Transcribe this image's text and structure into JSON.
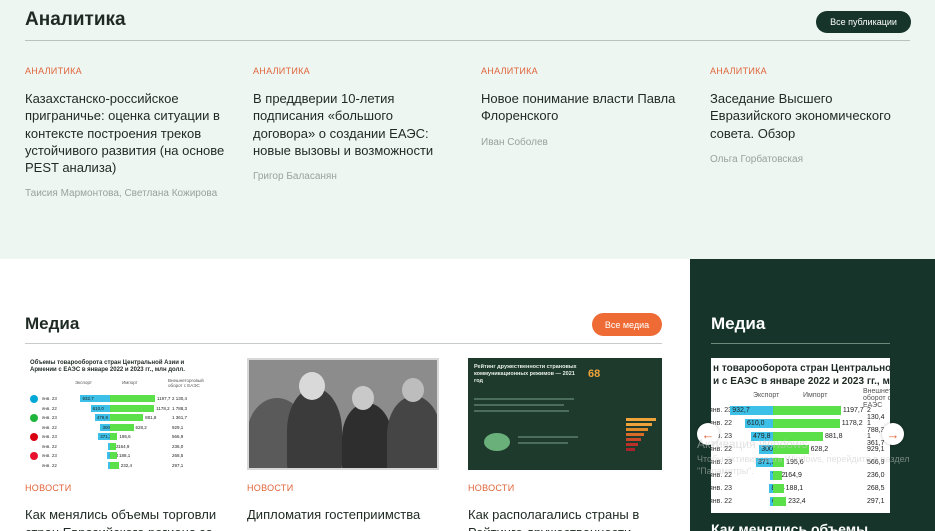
{
  "analytics": {
    "title": "Аналитика",
    "all_button": "Все публикации",
    "articles": [
      {
        "category": "АНАЛИТИКА",
        "title": "Казахстанско-российское приграничье: оценка ситуации в контексте построения треков устойчивого развития (на основе PEST анализа)",
        "author": "Таисия Мармонтова, Светлана Кожирова"
      },
      {
        "category": "АНАЛИТИКА",
        "title": "В преддверии 10-летия подписания «большого договора» о создании ЕАЭС: новые вызовы и возможности",
        "author": "Григор Баласанян"
      },
      {
        "category": "АНАЛИТИКА",
        "title": "Новое понимание власти Павла Флоренского",
        "author": "Иван Соболев"
      },
      {
        "category": "АНАЛИТИКА",
        "title": "Заседание Высшего Евразийского экономического совета. Обзор",
        "author": "Ольга Горбатовская"
      }
    ]
  },
  "media": {
    "title": "Медиа",
    "all_button": "Все медиа",
    "cards": [
      {
        "category": "НОВОСТИ",
        "title": "Как менялись объемы торговли стран Евразийского региона за"
      },
      {
        "category": "НОВОСТИ",
        "title": "Дипломатия гостеприимства"
      },
      {
        "category": "НОВОСТИ",
        "title": "Как располагались страны в Рейтинге дружественности"
      }
    ],
    "infographic": {
      "title": "Объемы товарооборота стран Центральной Азии и Армении с ЕАЭС в январе 2022 и 2023 гг., млн долл.",
      "col_export": "Экспорт",
      "col_import": "Импорт",
      "col_total": "Внешнеторговый оборот с ЕАЭС"
    },
    "report": {
      "title": "Рейтинг дружественности страновых коммуникационных режимов — 2021 год",
      "number": "68"
    }
  },
  "sidebar": {
    "title": "Медиа",
    "card_title_line1": "н товарооборота стран Центральной Азии",
    "card_title_line2": "и с ЕАЭС в январе 2022 и 2023 гг., млн долл.",
    "col_export": "Экспорт",
    "col_import": "Импорт",
    "col_total": "Внешнеторговый оборот с ЕАЭС",
    "prev_icon": "←",
    "next_icon": "→",
    "bottom_text": "Как менялись объемы"
  },
  "trade_rows": [
    {
      "year": "янв. 23",
      "export": 932.7,
      "import": 1197.7,
      "total": "2 130,4",
      "export_label": "932,7",
      "import_label": "1197,7",
      "flag": "#00a8d8"
    },
    {
      "year": "янв. 22",
      "export": 610.0,
      "import": 1178.2,
      "total": "1 788,3",
      "export_label": "610,0",
      "import_label": "1178,2",
      "flag": "#00a8d8"
    },
    {
      "year": "янв. 23",
      "export": 479.8,
      "import": 881.8,
      "total": "1 361,7",
      "export_label": "479,8",
      "import_label": "881,8",
      "flag": "#1eb53a"
    },
    {
      "year": "янв. 22",
      "export": 300.9,
      "import": 628.2,
      "total": "929,1",
      "export_label": "300,9",
      "import_label": "628,2",
      "flag": "#1eb53a"
    },
    {
      "year": "янв. 23",
      "export": 371.3,
      "import": 195.6,
      "total": "566,9",
      "export_label": "371,3",
      "import_label": "195,6",
      "flag": "#d90012"
    },
    {
      "year": "янв. 22",
      "export": 71.2,
      "import": 164.9,
      "total": "236,0",
      "export_label": "71,2",
      "import_label": "164,9",
      "flag": "#d90012"
    },
    {
      "year": "янв. 23",
      "export": 80.4,
      "import": 188.1,
      "total": "268,5",
      "export_label": "80,4",
      "import_label": "188,1",
      "flag": "#e8112d"
    },
    {
      "year": "янв. 22",
      "export": 64.7,
      "import": 232.4,
      "total": "297,1",
      "export_label": "64,7",
      "import_label": "232,4",
      "flag": "#e8112d"
    }
  ],
  "watermark": {
    "line1": "Активация Windows",
    "line2": "Чтобы активировать Windows, перейдите в раздел \"Параметры\"."
  },
  "colors": {
    "accent": "#ef6b36",
    "dark_green": "#16342a",
    "light_bg": "#eef6f2",
    "export_bar": "#3cc0e8",
    "import_bar": "#5be04a"
  }
}
